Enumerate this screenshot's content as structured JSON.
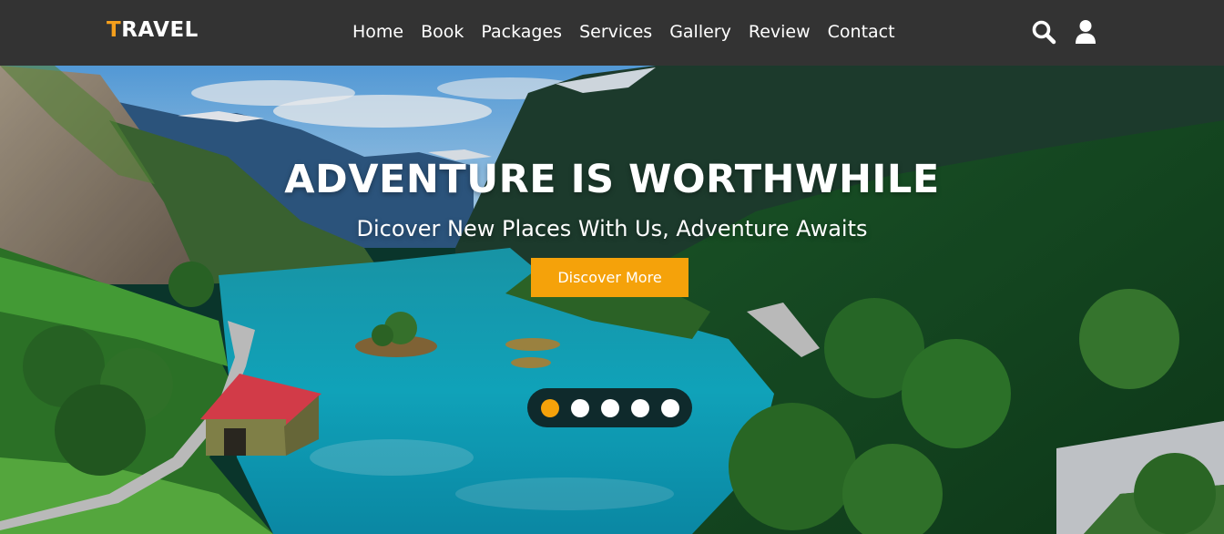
{
  "brand": {
    "first_letter": "T",
    "rest": "RAVEL",
    "accent": "#f59f1c"
  },
  "nav": {
    "items": [
      {
        "label": "Home"
      },
      {
        "label": "Book"
      },
      {
        "label": "Packages"
      },
      {
        "label": "Services"
      },
      {
        "label": "Gallery"
      },
      {
        "label": "Review"
      },
      {
        "label": "Contact"
      }
    ],
    "icons": [
      "search-icon",
      "user-icon"
    ]
  },
  "hero": {
    "title": "ADVENTURE IS WORTHWHILE",
    "subtitle": "Dicover New Places With Us, Adventure Awaits",
    "cta_label": "Discover More",
    "cta_color": "#f5a20a",
    "slides": {
      "count": 5,
      "active": 0
    }
  }
}
